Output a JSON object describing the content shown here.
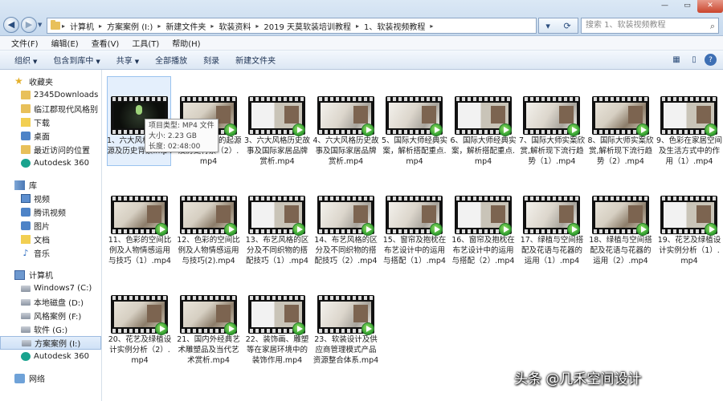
{
  "address": {
    "crumbs": [
      "计算机",
      "方案案例 (I:)",
      "新建文件夹",
      "软装资料",
      "2019 天莫软装培训教程",
      "1、软装视频教程"
    ],
    "search_placeholder": "搜索 1、软装视频教程"
  },
  "menu": [
    "文件(F)",
    "编辑(E)",
    "查看(V)",
    "工具(T)",
    "帮助(H)"
  ],
  "toolbar": [
    "组织",
    "包含到库中",
    "共享",
    "全部播放",
    "刻录",
    "新建文件夹"
  ],
  "sidebar": {
    "favorites_label": "收藏夹",
    "favorites": [
      "2345Downloads",
      "临江郡现代风格别",
      "下载",
      "桌面",
      "最近访问的位置",
      "Autodesk 360"
    ],
    "libraries_label": "库",
    "libraries": [
      "视频",
      "腾讯视频",
      "图片",
      "文档",
      "音乐"
    ],
    "computer_label": "计算机",
    "drives": [
      "Windows7 (C:)",
      "本地磁盘 (D:)",
      "风格案例 (F:)",
      "软件 (G:)",
      "方案案例 (I:)",
      "Autodesk 360"
    ],
    "network_label": "网络"
  },
  "files": [
    "1、六大风格历史起源及历史背景.mp4",
    "2、六大风格的起源及历史背景（2）.mp4",
    "3、六大风格历史故事及国际家居品牌赏析.mp4",
    "4、六大风格历史故事及国际家居品牌赏析.mp4",
    "5、国际大师经典实案，解析搭配重点.mp4",
    "6、国际大师经典实案，解析搭配重点.mp4",
    "7、国际大师实案欣赏,解析现下流行趋势（1）.mp4",
    "8、国际大师实案欣赏,解析现下流行趋势（2）.mp4",
    "9、色彩在家居空间及生活方式中的作用（1）.mp4",
    "11、色彩的空间比例及人物情感运用与技巧（1）.mp4",
    "12、色彩的空间比例及人物情感运用与技巧(2).mp4",
    "13、布艺风格的区分及不同织物的搭配技巧（1）.mp4",
    "14、布艺风格的区分及不同织物的搭配技巧（2）.mp4",
    "15、窗帘及抱枕在布艺设计中的运用与搭配（1）.mp4",
    "16、窗帘及抱枕在布艺设计中的运用与搭配（2）.mp4",
    "17、绿植与空间搭配及花语与花器的运用（1）.mp4",
    "18、绿植与空间搭配及花语与花器的运用（2）.mp4",
    "19、花艺及绿植设计实例分析（1）.mp4",
    "20、花艺及绿植设计实例分析（2）.mp4",
    "21、国内外经典艺术雕塑品及当代艺术赏析.mp4",
    "22、装饰画、雕塑等在家居环境中的装饰作用.mp4",
    "23、软装设计及供应商管理模式产品资源整合体系.mp4"
  ],
  "tooltip": {
    "type": "项目类型: MP4 文件",
    "size": "大小: 2.23 GB",
    "duration": "长度: 02:48:00"
  },
  "watermark": "头条 @几禾空间设计"
}
